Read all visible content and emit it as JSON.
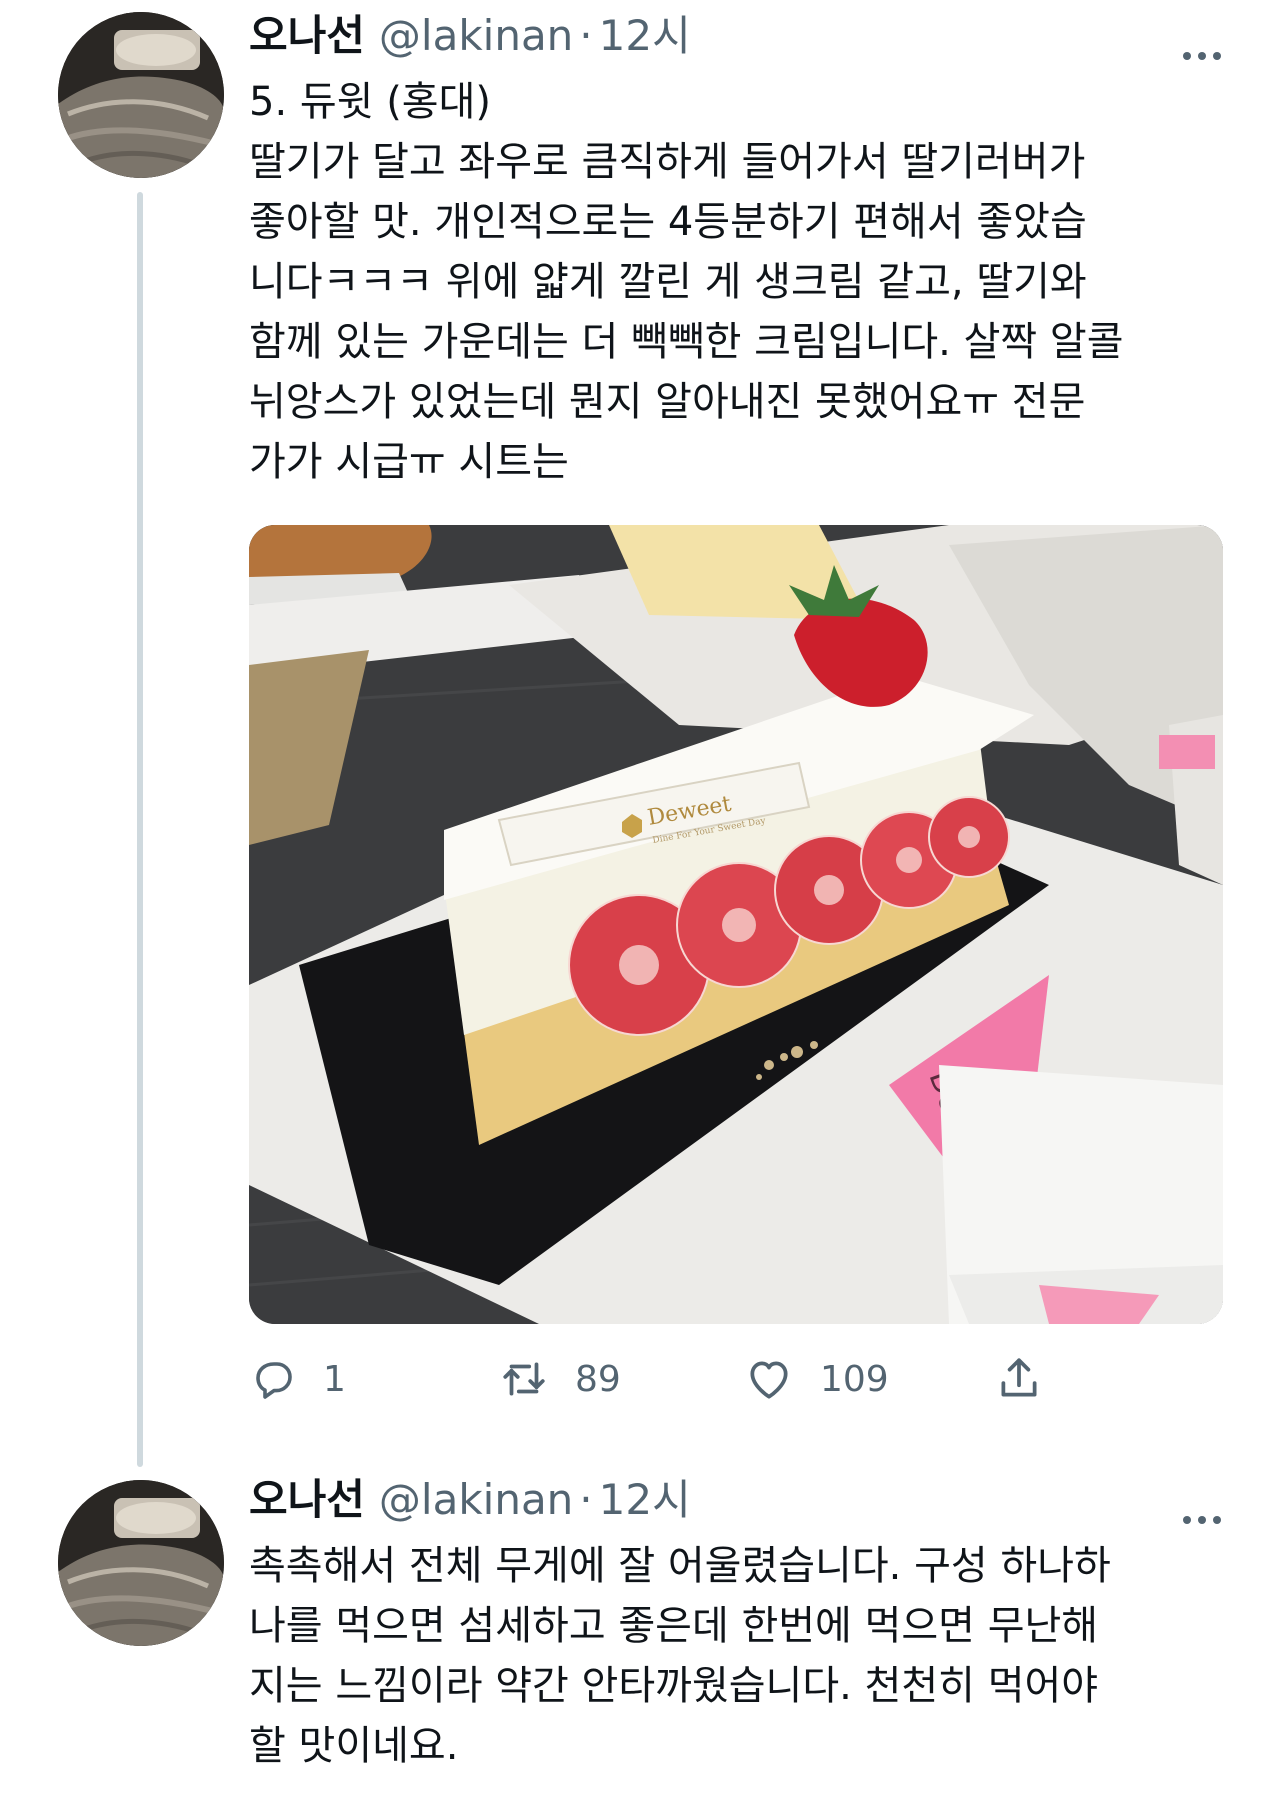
{
  "tweets": [
    {
      "name": "오나선",
      "handle": "@lakinan",
      "separator": "·",
      "time": "12시",
      "text": "5. 듀윗 (홍대)\n딸기가 달고 좌우로 큼직하게 들어가서 딸기러버가\n좋아할 맛. 개인적으로는 4등분하기 편해서 좋았습\n니다ㅋㅋㅋ 위에 얇게 깔린 게 생크림 같고, 딸기와\n함께 있는 가운데는 더 빽빽한 크림입니다. 살짝 알콜\n뉘앙스가 있었는데 뭔지 알아내진 못했어요ㅠ 전문\n가가 시급ㅠ 시트는",
      "image": {
        "label_main": "Deweet",
        "label_sub": "Dine For Your Sweet Day",
        "note_text": "Dewee"
      },
      "actions": {
        "reply_count": "1",
        "retweet_count": "89",
        "like_count": "109"
      }
    },
    {
      "name": "오나선",
      "handle": "@lakinan",
      "separator": "·",
      "time": "12시",
      "text": "촉촉해서 전체 무게에 잘 어울렸습니다. 구성 하나하\n나를 먹으면 섬세하고 좋은데 한번에 먹으면 무난해\n지는 느낌이라 약간 안타까웠습니다. 천천히 먹어야\n할 맛이네요."
    }
  ],
  "icons": {
    "more": "more-icon",
    "reply": "reply-icon",
    "retweet": "retweet-icon",
    "like": "like-icon",
    "share": "share-icon"
  },
  "colors": {
    "text": "#0f1419",
    "secondary": "#536471",
    "thread_line": "#cfd9de"
  }
}
